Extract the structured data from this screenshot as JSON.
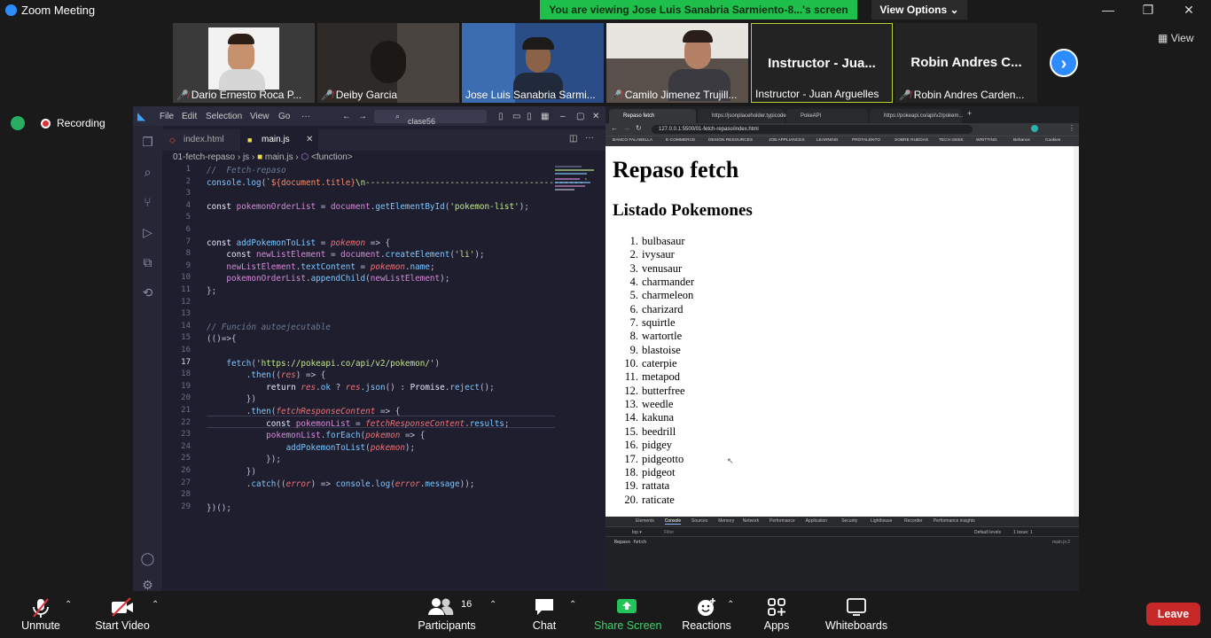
{
  "window": {
    "title": "Zoom Meeting",
    "share_banner": "You are viewing Jose Luis Sanabria Sarmiento-8...'s screen",
    "view_options": "View Options",
    "view_button": "View"
  },
  "participants": [
    {
      "name": "Dario Ernesto Roca P...",
      "muted": true
    },
    {
      "name": "Deiby Garcia",
      "muted": true
    },
    {
      "name": "Jose Luis Sanabria Sarmi...",
      "muted": false
    },
    {
      "name": "Camilo Jimenez Trujill...",
      "muted": true
    },
    {
      "name": "Instructor - Juan Arguelles",
      "big": "Instructor - Jua...",
      "muted": false,
      "active_speaker": true
    },
    {
      "name": "Robin Andres Carden...",
      "big": "Robin Andres C...",
      "muted": true
    }
  ],
  "recording": {
    "label": "Recording"
  },
  "vscode": {
    "menu": [
      "File",
      "Edit",
      "Selection",
      "View",
      "Go",
      "···"
    ],
    "search": "clase56",
    "tabs": [
      {
        "label": "index.html",
        "active": false
      },
      {
        "label": "main.js",
        "active": true
      }
    ],
    "breadcrumb": {
      "folder": "01-fetch-repaso",
      "sub": "js",
      "file": "main.js",
      "symbol": "<function>"
    },
    "current_line": 17
  },
  "browser": {
    "tabs": [
      "Repaso fetch",
      "https://jsonplaceholder.typicode...",
      "PokeAPI",
      "https://pokeapi.co/api/v2/pokem..."
    ],
    "url": "127.0.0.1:5500/01-fetch-repaso/index.html",
    "bookmarks": [
      "BANCO FALABELLA",
      "E-COMMERCE",
      "DESIGN RESOURCES",
      "JOB APPLIANCES",
      "LEARNING",
      "PROTALENTO",
      "SOBRE RUEDAS",
      "TECH GEEK",
      "WRITTING",
      "Behance",
      "Cookies"
    ],
    "page": {
      "h1": "Repaso fetch",
      "h2": "Listado Pokemones",
      "items": [
        "bulbasaur",
        "ivysaur",
        "venusaur",
        "charmander",
        "charmeleon",
        "charizard",
        "squirtle",
        "wartortle",
        "blastoise",
        "caterpie",
        "metapod",
        "butterfree",
        "weedle",
        "kakuna",
        "beedrill",
        "pidgey",
        "pidgeotto",
        "pidgeot",
        "rattata",
        "raticate"
      ]
    },
    "devtools": {
      "tabs": [
        "Elements",
        "Console",
        "Sources",
        "Memory",
        "Network",
        "Performance",
        "Application",
        "Security",
        "Lighthouse",
        "Recorder",
        "Performance insights"
      ],
      "active_tab": "Console",
      "filter_placeholder": "Filter",
      "levels": "Default levels",
      "issues": "1 Issue: 1",
      "log": "Repaso fetch",
      "log_src": "main.js:2"
    }
  },
  "toolbar": {
    "unmute": "Unmute",
    "start_video": "Start Video",
    "participants": "Participants",
    "participants_count": "16",
    "chat": "Chat",
    "share_screen": "Share Screen",
    "reactions": "Reactions",
    "apps": "Apps",
    "whiteboards": "Whiteboards",
    "leave": "Leave"
  },
  "colors": {
    "share_green": "#1fbf4c",
    "leave_red": "#c72828",
    "zoom_blue": "#2d8cff",
    "speaker_border": "#b6d42f"
  }
}
